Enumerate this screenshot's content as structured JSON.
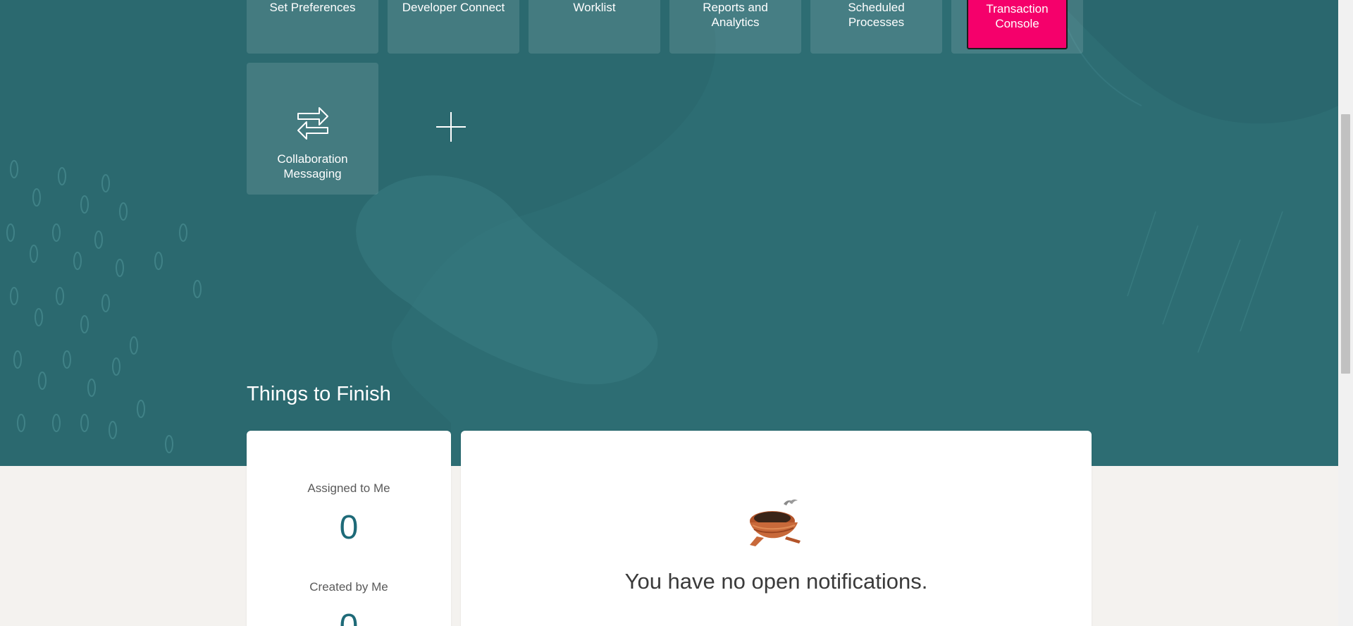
{
  "tiles_top": [
    {
      "label": "Set Preferences"
    },
    {
      "label": "Developer Connect"
    },
    {
      "label": "Worklist"
    },
    {
      "label": "Reports and Analytics"
    },
    {
      "label": "Scheduled Processes"
    },
    {
      "label": "Transaction Console"
    }
  ],
  "tile_collab": {
    "label": "Collaboration Messaging",
    "icon": "exchange-arrows-icon"
  },
  "add_button": {
    "icon": "plus-icon"
  },
  "things_to_finish": {
    "title": "Things to Finish",
    "assigned_label": "Assigned to Me",
    "assigned_count": "0",
    "created_label": "Created by Me",
    "created_count": "0",
    "notification_message": "You have no open notifications.",
    "empty_icon": "nest-icon"
  },
  "colors": {
    "hero_teal": "#2d6d73",
    "active_tile": "#f5006b",
    "count_teal": "#1e6a78"
  }
}
